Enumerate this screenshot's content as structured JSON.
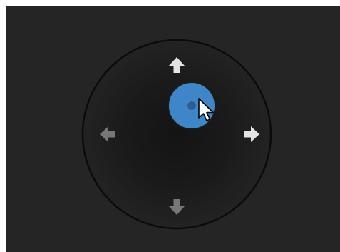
{
  "joystick": {
    "label": "",
    "directions": [
      "up",
      "right",
      "down",
      "left"
    ],
    "active_direction": "right",
    "knob_state": "hover"
  },
  "icons": {
    "up": "arrow-up-icon",
    "right": "arrow-right-icon",
    "down": "arrow-down-icon",
    "left": "arrow-left-icon",
    "cursor": "mouse-pointer-icon"
  },
  "colors": {
    "panel_background": "#252525",
    "ring_stroke": "#0b0b0b",
    "knob_fill": "#3f86c9",
    "knob_center": "#2c5f90",
    "arrow_active": "#e4e4e4",
    "arrow_inactive": "#777777"
  }
}
